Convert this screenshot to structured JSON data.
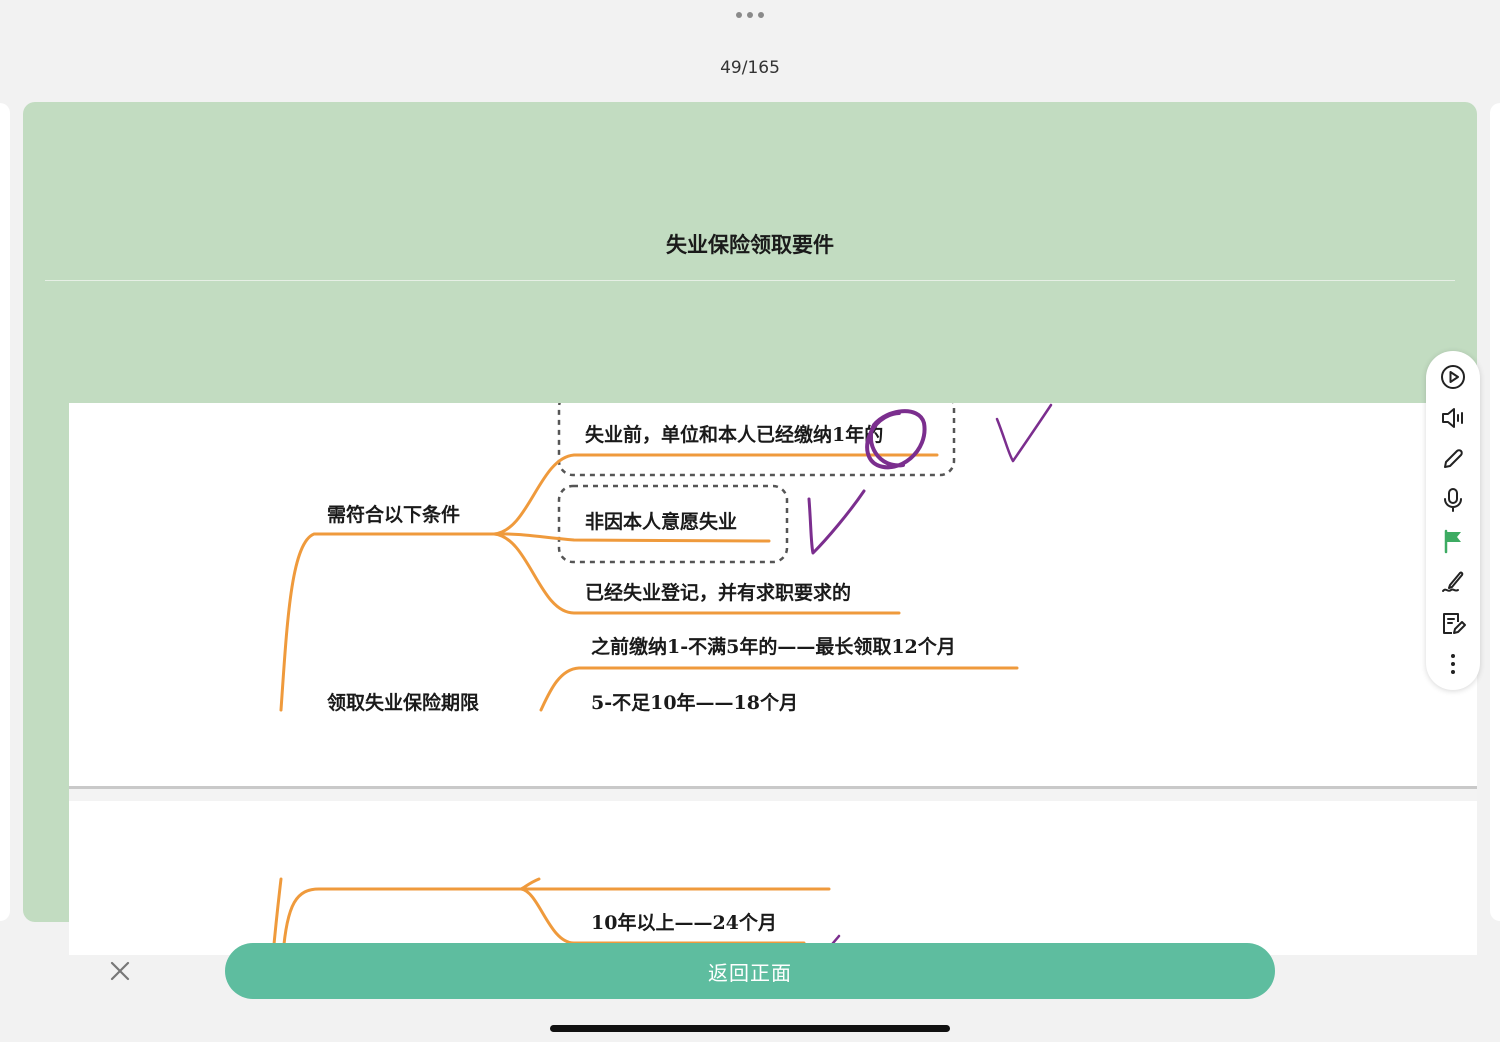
{
  "header": {
    "counter": "49/165"
  },
  "card": {
    "title": "失业保险领取要件",
    "mindmap": {
      "branch_conditions": "需符合以下条件",
      "condition_1": "失业前，单位和本人已经缴纳1年的",
      "condition_2": "非因本人意愿失业",
      "condition_3": "已经失业登记，并有求职要求的",
      "branch_period": "领取失业保险期限",
      "period_1": "之前缴纳1-不满5年的——最长领取12个月",
      "period_2": "5-不足10年——18个月",
      "period_3": "10年以上——24个月"
    }
  },
  "toolbar": {
    "items": [
      "play-icon",
      "speaker-icon",
      "pencil-icon",
      "microphone-icon",
      "flag-icon",
      "signature-icon",
      "note-edit-icon",
      "more-vertical-icon"
    ],
    "flag_color": "#3dab62"
  },
  "footer": {
    "flip_label": "返回正面"
  },
  "colors": {
    "card_bg": "#c2dcc1",
    "accent": "#5ebd9f",
    "branch_line": "#ef9a3c",
    "annotation": "#7b2e8e"
  }
}
